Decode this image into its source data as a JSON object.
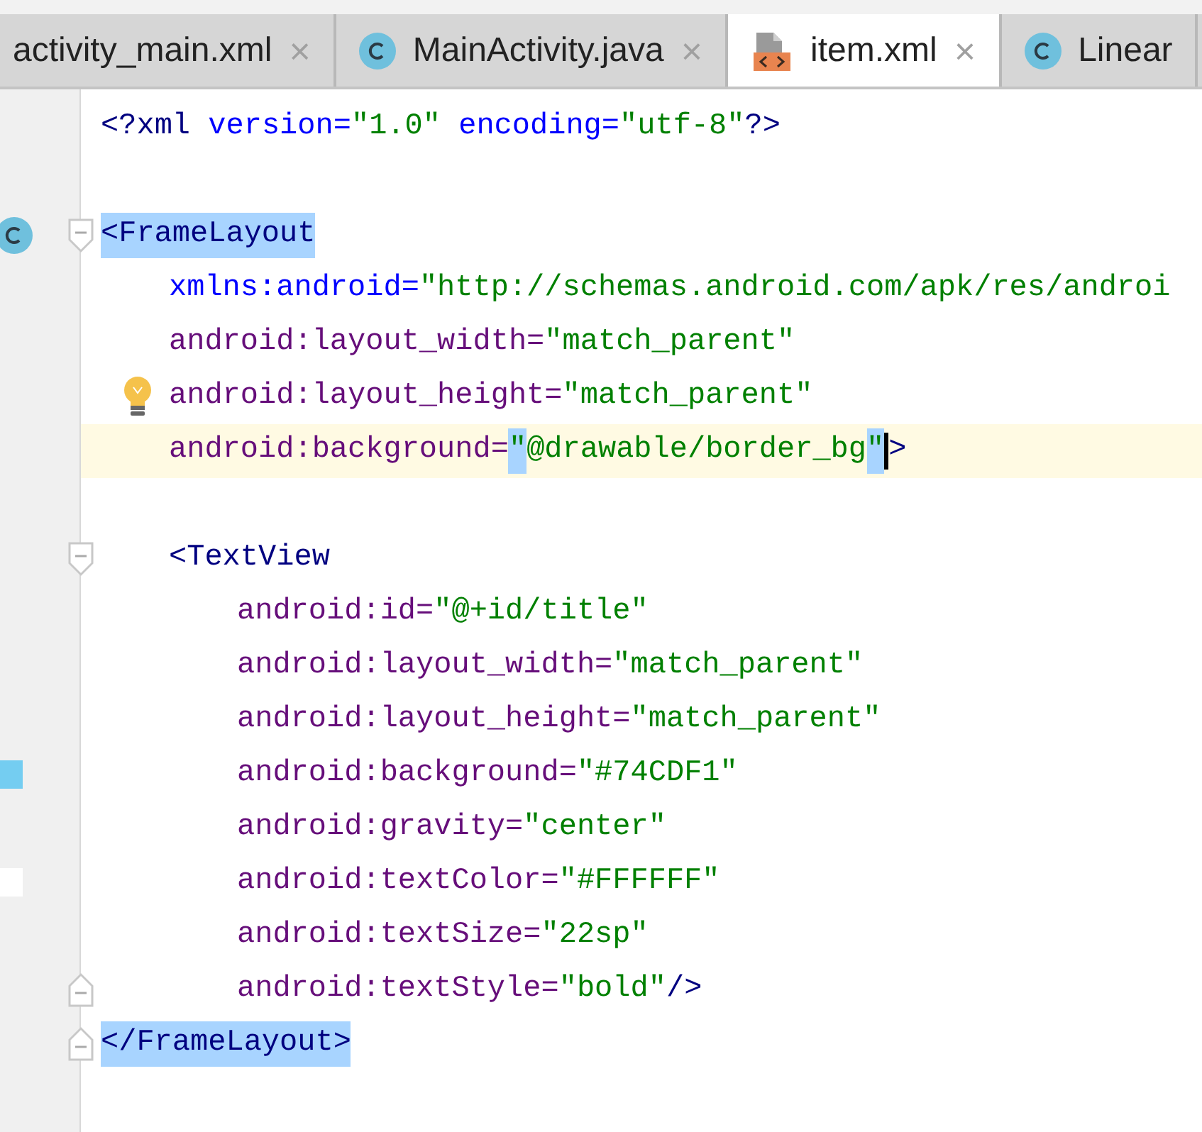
{
  "tabs": [
    {
      "label": "activity_main.xml",
      "kind": "plain",
      "selected": false,
      "closable": true
    },
    {
      "label": "MainActivity.java",
      "kind": "class",
      "selected": false,
      "closable": true
    },
    {
      "label": "item.xml",
      "kind": "xml",
      "selected": true,
      "closable": true
    },
    {
      "label": "Linear",
      "kind": "class",
      "selected": false,
      "closable": false
    }
  ],
  "close_glyph": "×",
  "lines": [
    {
      "fold_start": false,
      "fold_end": false,
      "class_marker": false,
      "bulb": false,
      "current": false,
      "tokens": [
        {
          "text": "<?",
          "kind": "tag"
        },
        {
          "text": "xml ",
          "kind": "tag"
        },
        {
          "text": "version=",
          "kind": "ns"
        },
        {
          "text": "\"1.0\"",
          "kind": "value"
        },
        {
          "text": " encoding=",
          "kind": "ns"
        },
        {
          "text": "\"utf-8\"",
          "kind": "value"
        },
        {
          "text": "?>",
          "kind": "tag"
        }
      ]
    },
    {
      "fold_start": false,
      "fold_end": false,
      "class_marker": false,
      "bulb": false,
      "current": false
    },
    {
      "fold_start": true,
      "fold_end": false,
      "class_marker": true,
      "bulb": false,
      "current": false,
      "tokens": [
        {
          "text": "<FrameLayout",
          "kind": "tag",
          "highlighted": true
        }
      ],
      "children": [
        {
          "fold_start": false,
          "fold_end": false,
          "class_marker": false,
          "bulb": false,
          "current": false,
          "tokens": [
            {
              "text": "xmlns:android=",
              "kind": "ns"
            },
            {
              "text": "\"http://schemas.android.com/apk/res/androi",
              "kind": "value"
            }
          ]
        },
        {
          "fold_start": false,
          "fold_end": false,
          "class_marker": false,
          "bulb": false,
          "current": false,
          "tokens": [
            {
              "text": "android:layout_width=",
              "kind": "attr"
            },
            {
              "text": "\"match_parent\"",
              "kind": "value"
            }
          ]
        },
        {
          "fold_start": false,
          "fold_end": false,
          "class_marker": false,
          "bulb": true,
          "current": false,
          "tokens": [
            {
              "text": "android:layout_height=",
              "kind": "attr"
            },
            {
              "text": "\"match_parent\"",
              "kind": "value"
            }
          ]
        },
        {
          "fold_start": false,
          "fold_end": false,
          "class_marker": false,
          "bulb": false,
          "current": true,
          "tokens": [
            {
              "text": "android:background=",
              "kind": "attr"
            },
            {
              "text": "\"",
              "kind": "value",
              "highlighted": true
            },
            {
              "text": "@drawable/border_bg",
              "kind": "value"
            },
            {
              "text": "\"",
              "kind": "value",
              "highlighted": true,
              "caret": true
            },
            {
              "text": ">",
              "kind": "tag"
            }
          ]
        },
        {
          "fold_start": false,
          "fold_end": false,
          "class_marker": false,
          "bulb": false,
          "current": false
        },
        {
          "fold_start": true,
          "fold_end": false,
          "class_marker": false,
          "bulb": false,
          "current": false,
          "tokens": [
            {
              "text": "<TextView",
              "kind": "tag"
            }
          ],
          "children": [
            {
              "fold_start": false,
              "fold_end": false,
              "class_marker": false,
              "bulb": false,
              "current": false,
              "tokens": [
                {
                  "text": "android:id=",
                  "kind": "attr"
                },
                {
                  "text": "\"@+id/title\"",
                  "kind": "value"
                }
              ]
            },
            {
              "fold_start": false,
              "fold_end": false,
              "class_marker": false,
              "bulb": false,
              "current": false,
              "tokens": [
                {
                  "text": "android:layout_width=",
                  "kind": "attr"
                },
                {
                  "text": "\"match_parent\"",
                  "kind": "value"
                }
              ]
            },
            {
              "fold_start": false,
              "fold_end": false,
              "class_marker": false,
              "bulb": false,
              "current": false,
              "tokens": [
                {
                  "text": "android:layout_height=",
                  "kind": "attr"
                },
                {
                  "text": "\"match_parent\"",
                  "kind": "value"
                }
              ]
            },
            {
              "fold_start": false,
              "fold_end": false,
              "class_marker": false,
              "bulb": false,
              "current": false,
              "color": "#74cdf1",
              "tokens": [
                {
                  "text": "android:background=",
                  "kind": "attr"
                },
                {
                  "text": "\"#74CDF1\"",
                  "kind": "value"
                }
              ]
            },
            {
              "fold_start": false,
              "fold_end": false,
              "class_marker": false,
              "bulb": false,
              "current": false,
              "tokens": [
                {
                  "text": "android:gravity=",
                  "kind": "attr"
                },
                {
                  "text": "\"center\"",
                  "kind": "value"
                }
              ]
            },
            {
              "fold_start": false,
              "fold_end": false,
              "class_marker": false,
              "bulb": false,
              "current": false,
              "color": "#ffffff",
              "tokens": [
                {
                  "text": "android:textColor=",
                  "kind": "attr"
                },
                {
                  "text": "\"#FFFFFF\"",
                  "kind": "value"
                }
              ]
            },
            {
              "fold_start": false,
              "fold_end": false,
              "class_marker": false,
              "bulb": false,
              "current": false,
              "tokens": [
                {
                  "text": "android:textSize=",
                  "kind": "attr"
                },
                {
                  "text": "\"22sp\"",
                  "kind": "value"
                }
              ]
            },
            {
              "fold_start": false,
              "fold_end": true,
              "class_marker": false,
              "bulb": false,
              "current": false,
              "tokens": [
                {
                  "text": "android:textStyle=",
                  "kind": "attr"
                },
                {
                  "text": "\"bold\"",
                  "kind": "value"
                },
                {
                  "text": "/>",
                  "kind": "tag"
                }
              ]
            }
          ]
        }
      ]
    },
    {
      "fold_start": false,
      "fold_end": true,
      "class_marker": false,
      "bulb": false,
      "current": false,
      "tokens": [
        {
          "text": "</FrameLayout>",
          "kind": "tag",
          "highlighted": true
        }
      ]
    }
  ]
}
